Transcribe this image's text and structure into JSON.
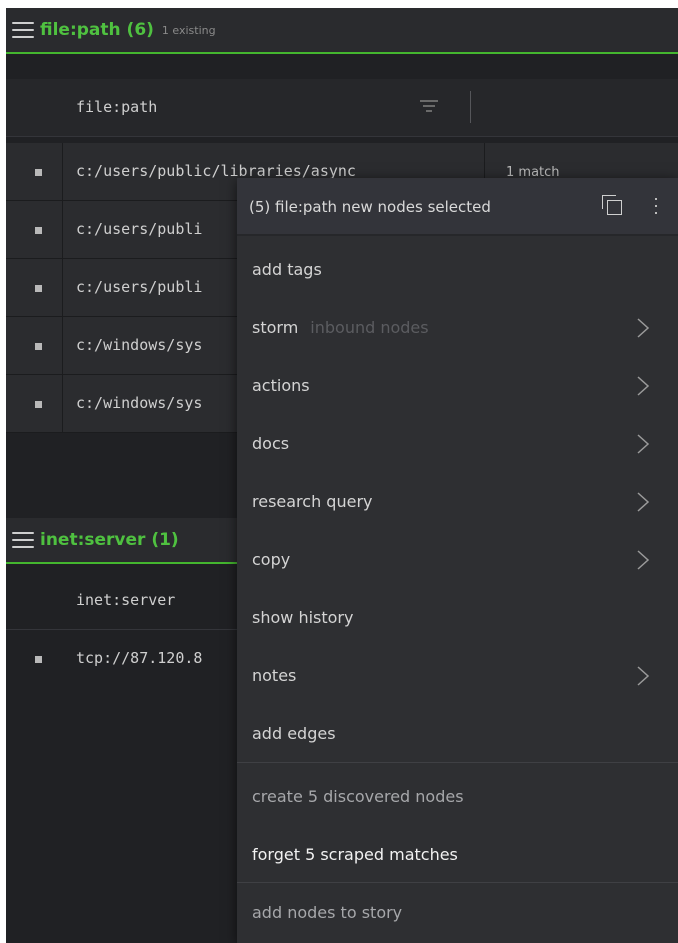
{
  "groups": [
    {
      "title": "file:path (6)",
      "subtitle": "1 existing",
      "column": "file:path",
      "rows": [
        {
          "value": "c:/users/public/libraries/async",
          "extra": "1 match"
        },
        {
          "value": "c:/users/publi",
          "extra": ""
        },
        {
          "value": "c:/users/publi",
          "extra": ""
        },
        {
          "value": "c:/windows/sys",
          "extra": ""
        },
        {
          "value": "c:/windows/sys",
          "extra": ""
        }
      ]
    },
    {
      "title": "inet:server (1)",
      "subtitle": "",
      "column": "inet:server",
      "rows": [
        {
          "value": "tcp://87.120.8",
          "extra": ""
        }
      ]
    }
  ],
  "menu": {
    "header": "(5) file:path new nodes selected",
    "items": [
      {
        "label": "add tags",
        "hint": "",
        "submenu": false
      },
      {
        "label": "storm",
        "hint": "inbound nodes",
        "submenu": true
      },
      {
        "label": "actions",
        "hint": "",
        "submenu": true
      },
      {
        "label": "docs",
        "hint": "",
        "submenu": true
      },
      {
        "label": "research query",
        "hint": "",
        "submenu": true
      },
      {
        "label": "copy",
        "hint": "",
        "submenu": true
      },
      {
        "label": "show history",
        "hint": "",
        "submenu": false
      },
      {
        "label": "notes",
        "hint": "",
        "submenu": true
      },
      {
        "label": "add edges",
        "hint": "",
        "submenu": false
      }
    ],
    "secondary": [
      {
        "label": "create 5 discovered nodes"
      },
      {
        "label": "forget 5 scraped matches"
      },
      {
        "label": "add nodes to story"
      }
    ]
  },
  "colors": {
    "accent": "#4fc140",
    "background": "#202124",
    "menu": "#2e2f32"
  }
}
